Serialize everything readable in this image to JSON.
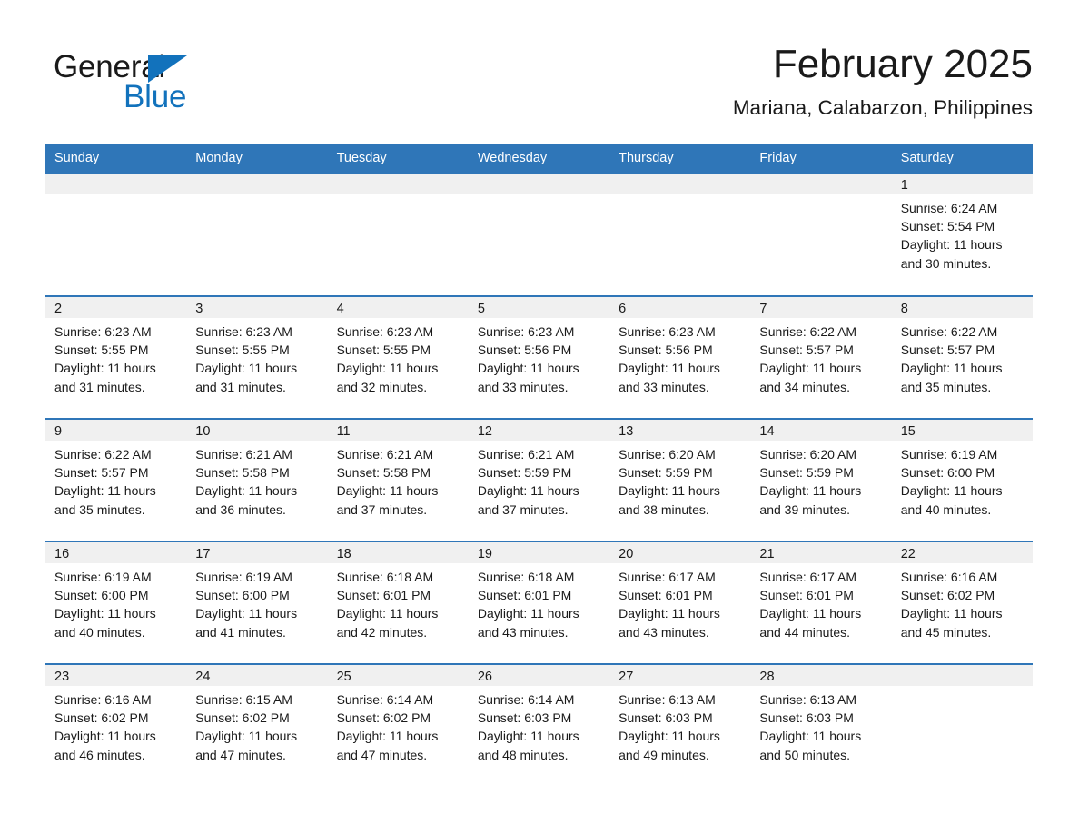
{
  "brand": {
    "name_part1": "General",
    "name_part2": "Blue",
    "accent_color": "#1272bc"
  },
  "header": {
    "month_title": "February 2025",
    "location": "Mariana, Calabarzon, Philippines"
  },
  "theme": {
    "header_row_color": "#2f76b8",
    "daynum_band_color": "#f0f0f0",
    "text_color": "#1a1a1a",
    "page_background": "#ffffff"
  },
  "weekday_headers": [
    "Sunday",
    "Monday",
    "Tuesday",
    "Wednesday",
    "Thursday",
    "Friday",
    "Saturday"
  ],
  "labels": {
    "sunrise_prefix": "Sunrise:",
    "sunset_prefix": "Sunset:",
    "daylight_prefix": "Daylight:"
  },
  "weeks": [
    [
      {
        "day": "",
        "empty": true
      },
      {
        "day": "",
        "empty": true
      },
      {
        "day": "",
        "empty": true
      },
      {
        "day": "",
        "empty": true
      },
      {
        "day": "",
        "empty": true
      },
      {
        "day": "",
        "empty": true
      },
      {
        "day": "1",
        "sunrise": "Sunrise: 6:24 AM",
        "sunset": "Sunset: 5:54 PM",
        "daylight": "Daylight: 11 hours and 30 minutes."
      }
    ],
    [
      {
        "day": "2",
        "sunrise": "Sunrise: 6:23 AM",
        "sunset": "Sunset: 5:55 PM",
        "daylight": "Daylight: 11 hours and 31 minutes."
      },
      {
        "day": "3",
        "sunrise": "Sunrise: 6:23 AM",
        "sunset": "Sunset: 5:55 PM",
        "daylight": "Daylight: 11 hours and 31 minutes."
      },
      {
        "day": "4",
        "sunrise": "Sunrise: 6:23 AM",
        "sunset": "Sunset: 5:55 PM",
        "daylight": "Daylight: 11 hours and 32 minutes."
      },
      {
        "day": "5",
        "sunrise": "Sunrise: 6:23 AM",
        "sunset": "Sunset: 5:56 PM",
        "daylight": "Daylight: 11 hours and 33 minutes."
      },
      {
        "day": "6",
        "sunrise": "Sunrise: 6:23 AM",
        "sunset": "Sunset: 5:56 PM",
        "daylight": "Daylight: 11 hours and 33 minutes."
      },
      {
        "day": "7",
        "sunrise": "Sunrise: 6:22 AM",
        "sunset": "Sunset: 5:57 PM",
        "daylight": "Daylight: 11 hours and 34 minutes."
      },
      {
        "day": "8",
        "sunrise": "Sunrise: 6:22 AM",
        "sunset": "Sunset: 5:57 PM",
        "daylight": "Daylight: 11 hours and 35 minutes."
      }
    ],
    [
      {
        "day": "9",
        "sunrise": "Sunrise: 6:22 AM",
        "sunset": "Sunset: 5:57 PM",
        "daylight": "Daylight: 11 hours and 35 minutes."
      },
      {
        "day": "10",
        "sunrise": "Sunrise: 6:21 AM",
        "sunset": "Sunset: 5:58 PM",
        "daylight": "Daylight: 11 hours and 36 minutes."
      },
      {
        "day": "11",
        "sunrise": "Sunrise: 6:21 AM",
        "sunset": "Sunset: 5:58 PM",
        "daylight": "Daylight: 11 hours and 37 minutes."
      },
      {
        "day": "12",
        "sunrise": "Sunrise: 6:21 AM",
        "sunset": "Sunset: 5:59 PM",
        "daylight": "Daylight: 11 hours and 37 minutes."
      },
      {
        "day": "13",
        "sunrise": "Sunrise: 6:20 AM",
        "sunset": "Sunset: 5:59 PM",
        "daylight": "Daylight: 11 hours and 38 minutes."
      },
      {
        "day": "14",
        "sunrise": "Sunrise: 6:20 AM",
        "sunset": "Sunset: 5:59 PM",
        "daylight": "Daylight: 11 hours and 39 minutes."
      },
      {
        "day": "15",
        "sunrise": "Sunrise: 6:19 AM",
        "sunset": "Sunset: 6:00 PM",
        "daylight": "Daylight: 11 hours and 40 minutes."
      }
    ],
    [
      {
        "day": "16",
        "sunrise": "Sunrise: 6:19 AM",
        "sunset": "Sunset: 6:00 PM",
        "daylight": "Daylight: 11 hours and 40 minutes."
      },
      {
        "day": "17",
        "sunrise": "Sunrise: 6:19 AM",
        "sunset": "Sunset: 6:00 PM",
        "daylight": "Daylight: 11 hours and 41 minutes."
      },
      {
        "day": "18",
        "sunrise": "Sunrise: 6:18 AM",
        "sunset": "Sunset: 6:01 PM",
        "daylight": "Daylight: 11 hours and 42 minutes."
      },
      {
        "day": "19",
        "sunrise": "Sunrise: 6:18 AM",
        "sunset": "Sunset: 6:01 PM",
        "daylight": "Daylight: 11 hours and 43 minutes."
      },
      {
        "day": "20",
        "sunrise": "Sunrise: 6:17 AM",
        "sunset": "Sunset: 6:01 PM",
        "daylight": "Daylight: 11 hours and 43 minutes."
      },
      {
        "day": "21",
        "sunrise": "Sunrise: 6:17 AM",
        "sunset": "Sunset: 6:01 PM",
        "daylight": "Daylight: 11 hours and 44 minutes."
      },
      {
        "day": "22",
        "sunrise": "Sunrise: 6:16 AM",
        "sunset": "Sunset: 6:02 PM",
        "daylight": "Daylight: 11 hours and 45 minutes."
      }
    ],
    [
      {
        "day": "23",
        "sunrise": "Sunrise: 6:16 AM",
        "sunset": "Sunset: 6:02 PM",
        "daylight": "Daylight: 11 hours and 46 minutes."
      },
      {
        "day": "24",
        "sunrise": "Sunrise: 6:15 AM",
        "sunset": "Sunset: 6:02 PM",
        "daylight": "Daylight: 11 hours and 47 minutes."
      },
      {
        "day": "25",
        "sunrise": "Sunrise: 6:14 AM",
        "sunset": "Sunset: 6:02 PM",
        "daylight": "Daylight: 11 hours and 47 minutes."
      },
      {
        "day": "26",
        "sunrise": "Sunrise: 6:14 AM",
        "sunset": "Sunset: 6:03 PM",
        "daylight": "Daylight: 11 hours and 48 minutes."
      },
      {
        "day": "27",
        "sunrise": "Sunrise: 6:13 AM",
        "sunset": "Sunset: 6:03 PM",
        "daylight": "Daylight: 11 hours and 49 minutes."
      },
      {
        "day": "28",
        "sunrise": "Sunrise: 6:13 AM",
        "sunset": "Sunset: 6:03 PM",
        "daylight": "Daylight: 11 hours and 50 minutes."
      },
      {
        "day": "",
        "blank": true
      }
    ]
  ]
}
